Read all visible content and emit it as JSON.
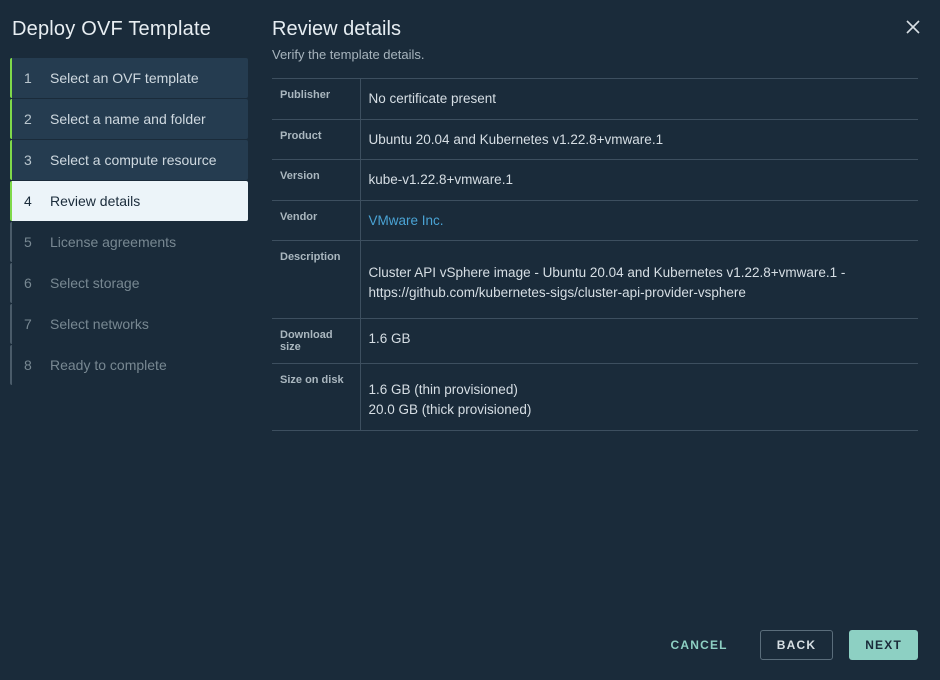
{
  "sidebar": {
    "title": "Deploy OVF Template",
    "steps": [
      {
        "num": "1",
        "label": "Select an OVF template",
        "state": "completed"
      },
      {
        "num": "2",
        "label": "Select a name and folder",
        "state": "completed"
      },
      {
        "num": "3",
        "label": "Select a compute resource",
        "state": "completed"
      },
      {
        "num": "4",
        "label": "Review details",
        "state": "active"
      },
      {
        "num": "5",
        "label": "License agreements",
        "state": "future"
      },
      {
        "num": "6",
        "label": "Select storage",
        "state": "future"
      },
      {
        "num": "7",
        "label": "Select networks",
        "state": "future"
      },
      {
        "num": "8",
        "label": "Ready to complete",
        "state": "future"
      }
    ]
  },
  "header": {
    "title": "Review details",
    "subtitle": "Verify the template details."
  },
  "details": {
    "publisher": {
      "label": "Publisher",
      "value": "No certificate present"
    },
    "product": {
      "label": "Product",
      "value": "Ubuntu 20.04 and Kubernetes v1.22.8+vmware.1"
    },
    "version": {
      "label": "Version",
      "value": "kube-v1.22.8+vmware.1"
    },
    "vendor": {
      "label": "Vendor",
      "value": "VMware Inc."
    },
    "description": {
      "label": "Description",
      "value": "Cluster API vSphere image - Ubuntu 20.04 and Kubernetes v1.22.8+vmware.1 - https://github.com/kubernetes-sigs/cluster-api-provider-vsphere"
    },
    "download_size": {
      "label": "Download size",
      "value": "1.6 GB"
    },
    "size_on_disk": {
      "label": "Size on disk",
      "thin": "1.6 GB (thin provisioned)",
      "thick": "20.0 GB (thick provisioned)"
    }
  },
  "footer": {
    "cancel": "CANCEL",
    "back": "BACK",
    "next": "NEXT"
  }
}
